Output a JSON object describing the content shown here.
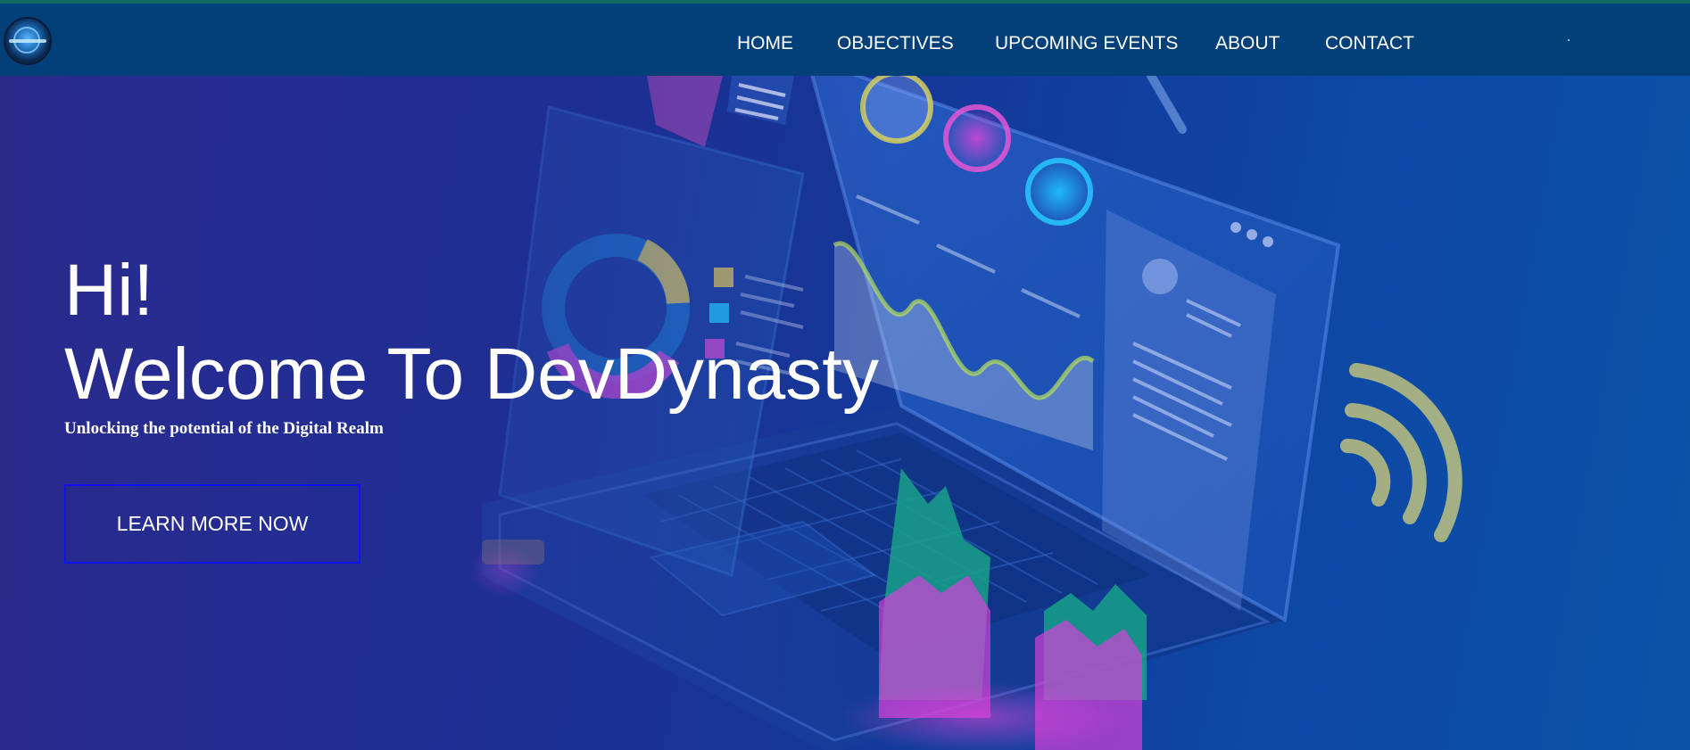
{
  "nav": {
    "items": [
      {
        "label": "HOME"
      },
      {
        "label": "OBJECTIVES"
      },
      {
        "label": "UPCOMING EVENTS"
      },
      {
        "label": "ABOUT"
      },
      {
        "label": "CONTACT"
      }
    ]
  },
  "hero": {
    "greeting": "Hi!",
    "headline": "Welcome To DevDynasty",
    "tagline": "Unlocking the potential of the Digital Realm",
    "cta_label": "LEARN MORE NOW"
  },
  "colors": {
    "navbar": "#033f78",
    "top_accent": "#0f6a66",
    "cta_border": "#1010ff",
    "text": "#ffffff"
  },
  "icons": {
    "logo": "devdynasty-globe-logo"
  }
}
